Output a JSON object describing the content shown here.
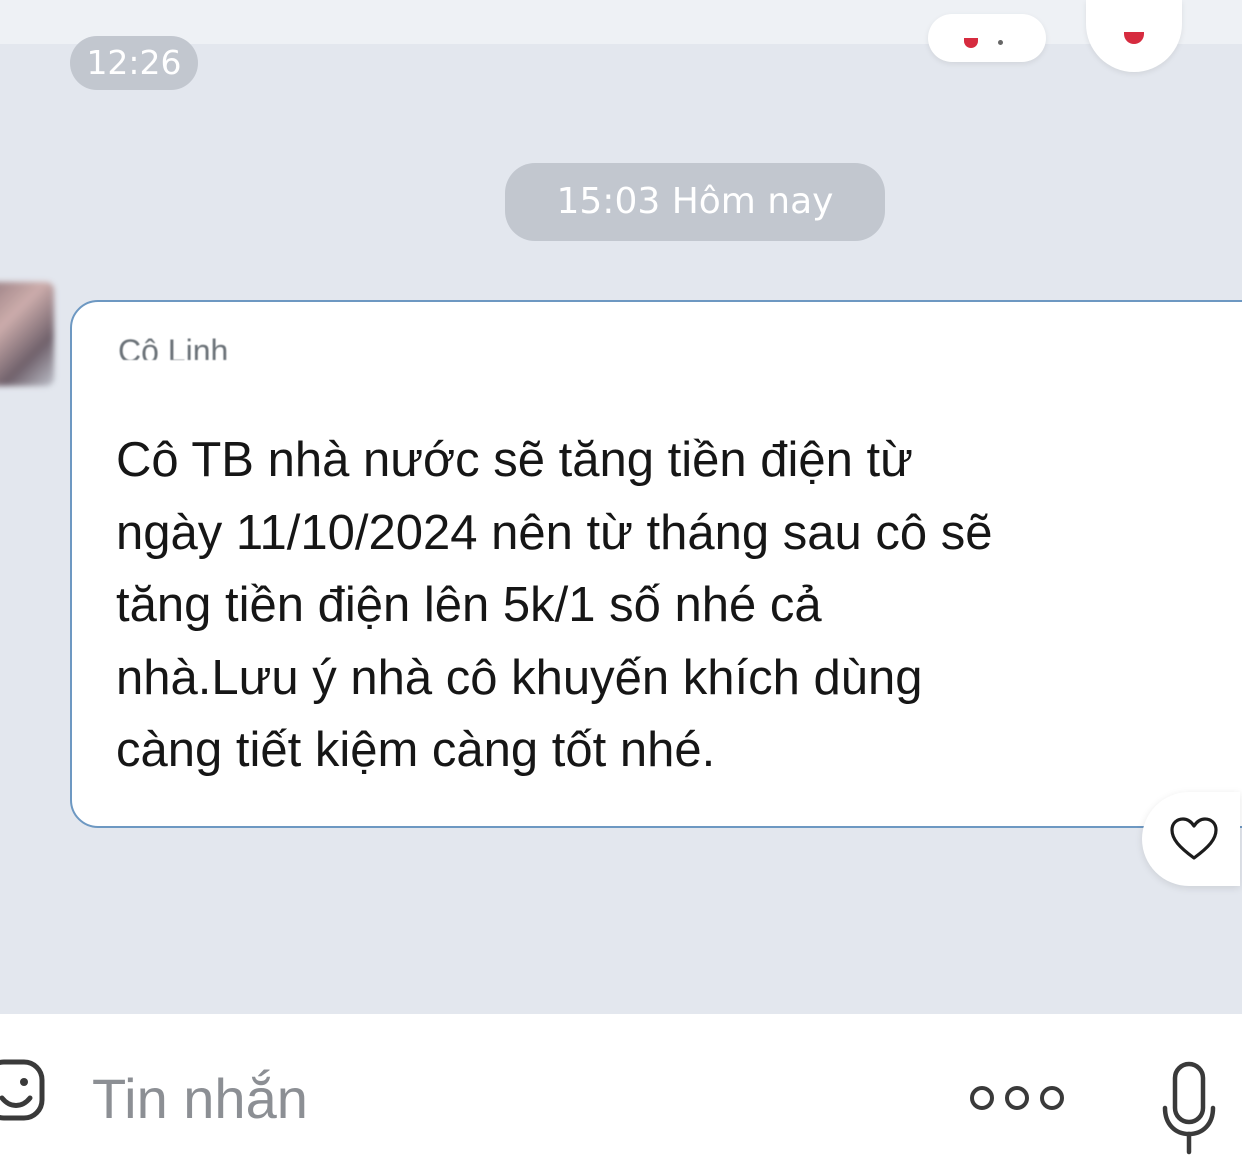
{
  "header": {
    "previous_time": "12:26",
    "current_time_label": "15:03 Hôm nay"
  },
  "message": {
    "sender_name": "Cô Linh",
    "text": "Cô TB nhà nước sẽ tăng tiền điện từ\nngày 11/10/2024 nên từ tháng sau cô sẽ\ntăng tiền điện lên 5k/1 số nhé cả\nnhà.Lưu ý nhà cô khuyến khích dùng\ncàng tiết kiệm càng tốt nhé.",
    "reaction_icon": "heart-outline-icon"
  },
  "composer": {
    "placeholder": "Tin nhắn",
    "left_icon": "emoji-icon",
    "more_icon": "more-options-icon",
    "mic_icon": "microphone-icon"
  },
  "colors": {
    "chat_background": "#e3e7ee",
    "bubble_border": "#6d98c2",
    "time_chip": "#c2c7cf",
    "reaction_red": "#d62b3f"
  }
}
